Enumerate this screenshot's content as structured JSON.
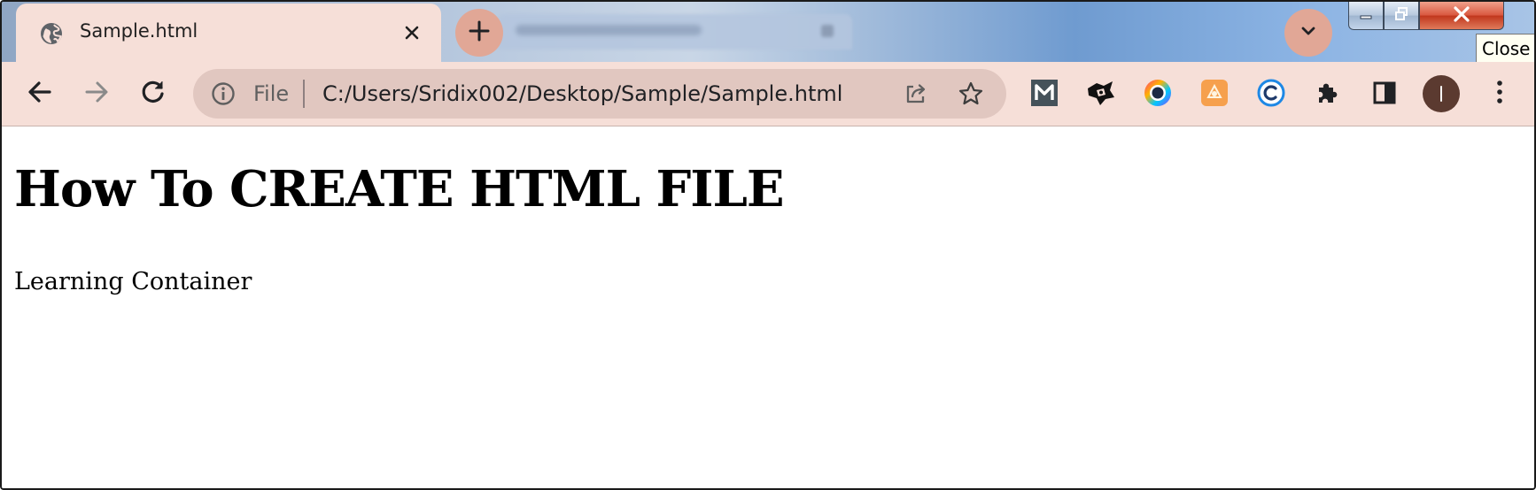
{
  "browser": {
    "tab": {
      "title": "Sample.html",
      "favicon": "globe-icon",
      "close_icon": "close-icon"
    },
    "new_tab_icon": "plus-icon",
    "tab_search_icon": "chevron-down-icon",
    "tooltip": "Close",
    "window_controls": [
      "minimize-icon",
      "restore-icon",
      "close-icon"
    ],
    "toolbar": {
      "back_icon": "arrow-left-icon",
      "forward_icon": "arrow-right-icon",
      "reload_icon": "reload-icon"
    },
    "omnibox": {
      "info_icon": "info-icon",
      "scheme_label": "File",
      "url": "C:/Users/Sridix002/Desktop/Sample/Sample.html",
      "share_icon": "share-icon",
      "bookmark_icon": "star-icon"
    },
    "extensions": [
      "m-extension-icon",
      "dark-extension-icon",
      "colorpick-extension-icon",
      "orange-extension-icon",
      "copyright-extension-icon",
      "puzzle-icon",
      "side-panel-icon"
    ],
    "profile_avatar": "avatar-icon",
    "menu_icon": "kebab-menu-icon"
  },
  "page": {
    "heading": "How To CREATE HTML FILE",
    "paragraph": "Learning Container"
  },
  "colors": {
    "chrome_bg": "#f6dfd8",
    "omnibox_bg": "#e1c7c0",
    "accent_button": "#e1a796",
    "avatar": "#5b3a30"
  }
}
